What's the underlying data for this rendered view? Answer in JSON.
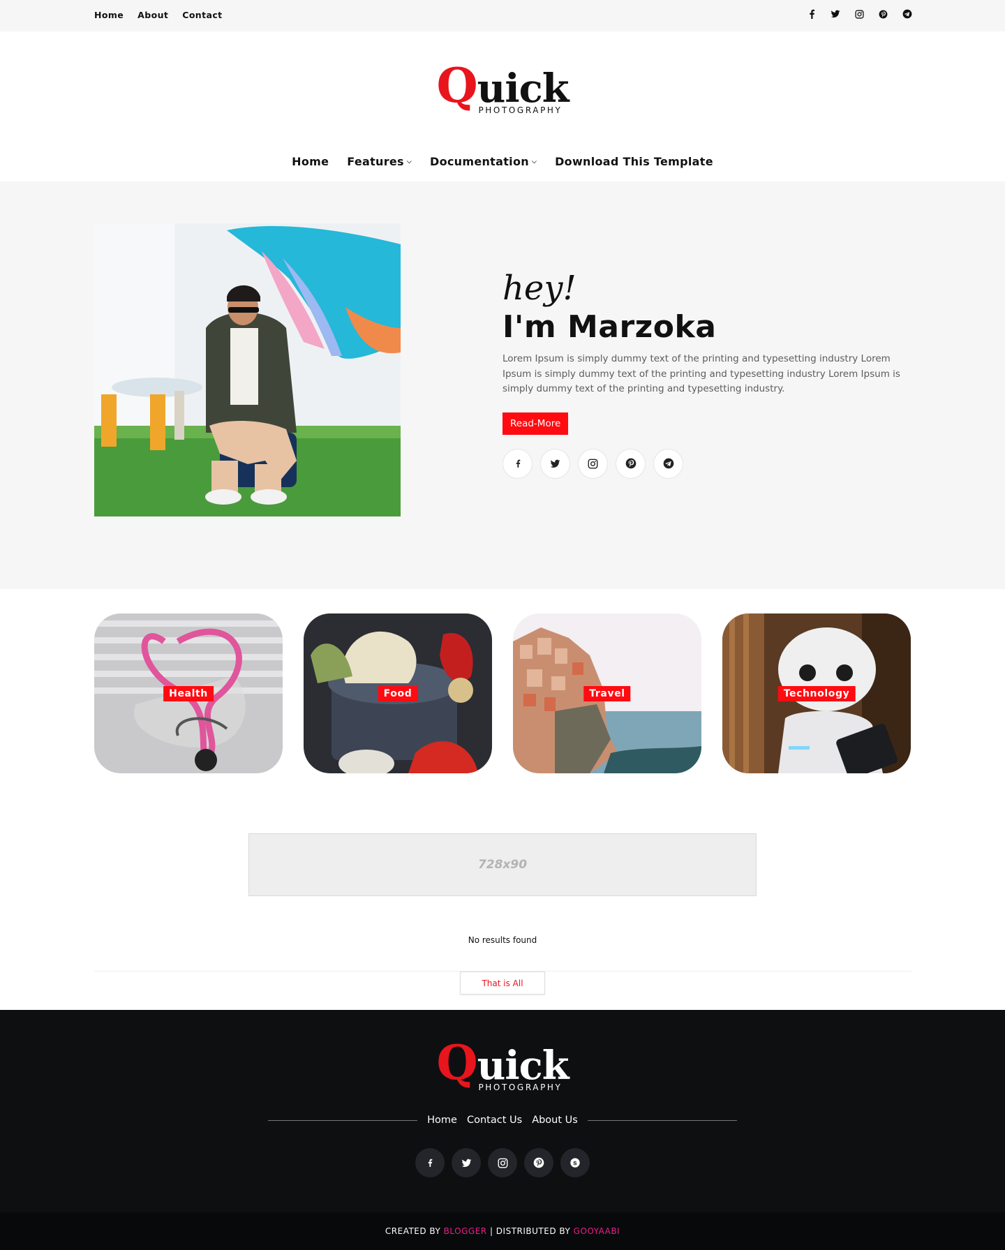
{
  "topbar": {
    "links": [
      "Home",
      "About",
      "Contact"
    ],
    "icons": [
      "facebook-icon",
      "twitter-icon",
      "instagram-icon",
      "pinterest-icon",
      "telegram-icon"
    ]
  },
  "logo": {
    "q": "Q",
    "rest": "uick",
    "sub": "PHOTOGRAPHY"
  },
  "nav": {
    "home": "Home",
    "features": "Features",
    "documentation": "Documentation",
    "download": "Download This Template"
  },
  "hero": {
    "greeting": "hey!",
    "name": "I'm Marzoka",
    "description": "Lorem Ipsum is simply dummy text of the printing and typesetting industry Lorem Ipsum is simply dummy text of the printing and typesetting industry Lorem Ipsum is simply dummy text of the printing and typesetting industry.",
    "button": "Read-More",
    "socials": [
      "facebook-icon",
      "twitter-icon",
      "instagram-icon",
      "pinterest-icon",
      "telegram-icon"
    ]
  },
  "categories": [
    "Health",
    "Food",
    "Travel",
    "Technology"
  ],
  "ad": {
    "label": "728x90"
  },
  "posts": {
    "empty": "No results found",
    "end_button": "That is All"
  },
  "footer": {
    "links": [
      "Home",
      "Contact Us",
      "About Us"
    ],
    "socials": [
      "facebook-icon",
      "twitter-icon",
      "instagram-icon",
      "pinterest-icon",
      "skype-icon"
    ],
    "copyright": {
      "created": "CREATED BY",
      "blogger": "BLOGGER",
      "distributed": "| DISTRIBUTED BY",
      "gooyaabi": "GOOYAABI"
    }
  },
  "colors": {
    "accent": "#ff0b11",
    "footer_bg": "#0e0f11",
    "credit_pink": "#e91e8c"
  }
}
